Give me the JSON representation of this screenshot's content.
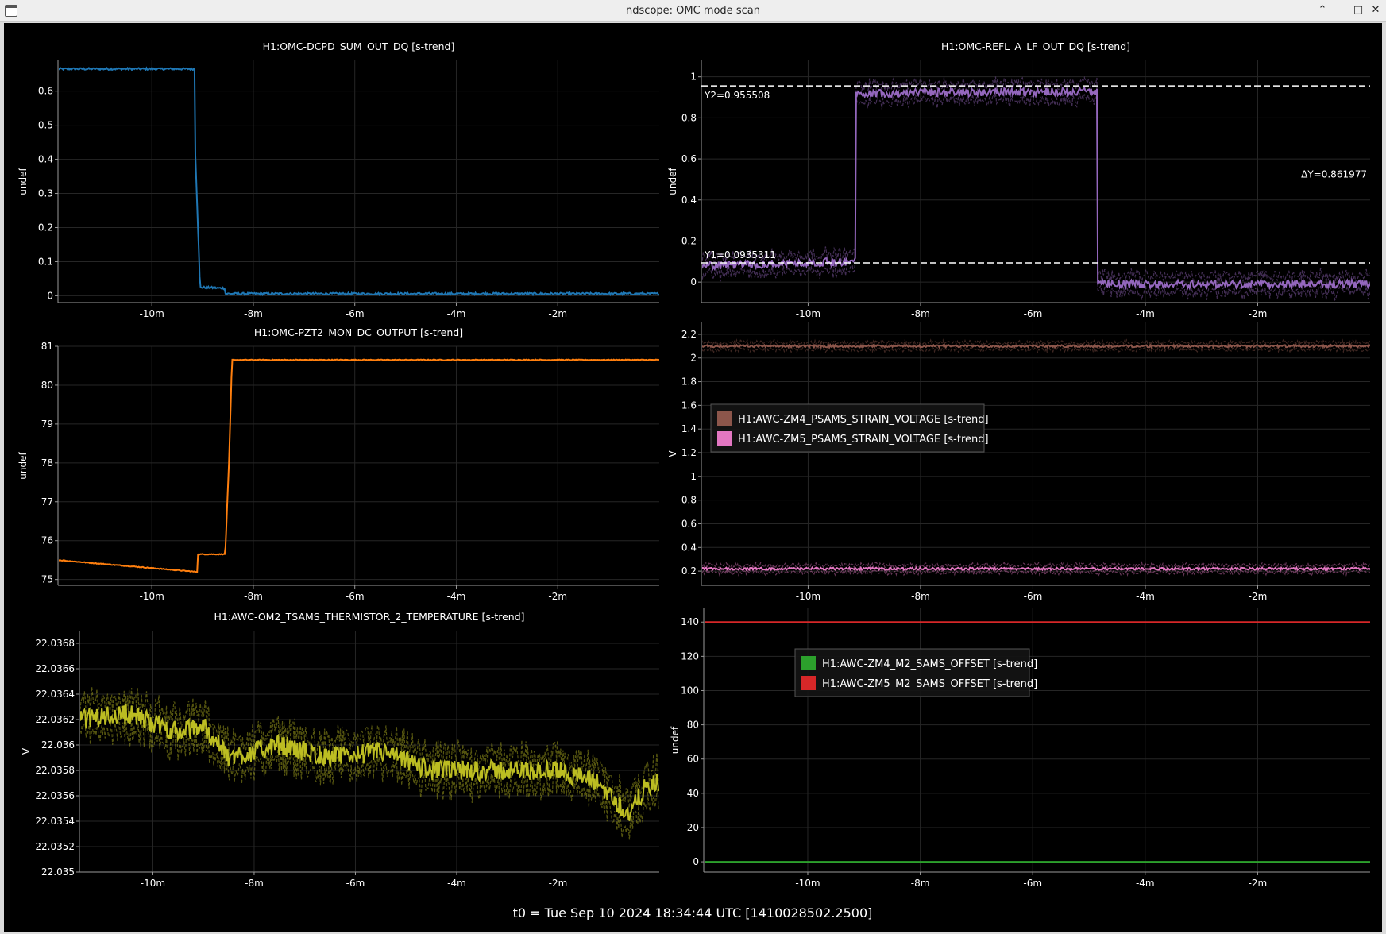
{
  "window": {
    "title": "ndscope: OMC mode scan",
    "app_icon": "window-icon",
    "buttons": [
      {
        "name": "keep-above-button",
        "glyph": "⌃"
      },
      {
        "name": "minimize-button",
        "glyph": "–"
      },
      {
        "name": "maximize-button",
        "glyph": "□"
      },
      {
        "name": "close-button",
        "glyph": "✕"
      }
    ]
  },
  "footer": {
    "t0": "t0 = Tue Sep 10 2024 18:34:44 UTC [1410028502.2500]"
  },
  "colors": {
    "background": "#000000",
    "blue": "#1f77b4",
    "orange": "#ff7f0e",
    "purple": "#9467bd",
    "brown": "#8c564b",
    "pink": "#e377c2",
    "yellow": "#bcbd22",
    "green": "#2ca02c",
    "red": "#d62728"
  },
  "chart_data": [
    {
      "id": "omc-dcpd",
      "type": "line",
      "title": "H1:OMC-DCPD_SUM_OUT_DQ [s-trend]",
      "ylabel": "undef",
      "xlim": [
        -11.85,
        -0.0
      ],
      "ylim": [
        -0.02,
        0.69
      ],
      "xticks": [
        -10,
        -8,
        -6,
        -4,
        -2
      ],
      "xtick_labels": [
        "-10m",
        "-8m",
        "-6m",
        "-4m",
        "-2m"
      ],
      "yticks": [
        0,
        0.1,
        0.2,
        0.3,
        0.4,
        0.5,
        0.6
      ],
      "ytick_labels": [
        "0",
        "0.1",
        "0.2",
        "0.3",
        "0.4",
        "0.5",
        "0.6"
      ],
      "series": [
        {
          "color": "#1f77b4",
          "noise": 0.003,
          "x": [
            -11.85,
            -9.15,
            -9.15,
            -9.05,
            -9.05,
            -8.55,
            -8.55,
            0.0
          ],
          "y": [
            0.665,
            0.665,
            0.45,
            0.025,
            0.025,
            0.022,
            0.006,
            0.006
          ]
        }
      ]
    },
    {
      "id": "omc-pzt2",
      "type": "line",
      "title": "H1:OMC-PZT2_MON_DC_OUTPUT [s-trend]",
      "ylabel": "undef",
      "xlim": [
        -11.85,
        -0.0
      ],
      "ylim": [
        74.85,
        81.0
      ],
      "xticks": [
        -10,
        -8,
        -6,
        -4,
        -2
      ],
      "xtick_labels": [
        "-10m",
        "-8m",
        "-6m",
        "-4m",
        "-2m"
      ],
      "yticks": [
        75,
        76,
        77,
        78,
        79,
        80,
        81
      ],
      "ytick_labels": [
        "75",
        "76",
        "77",
        "78",
        "79",
        "80",
        "81"
      ],
      "series": [
        {
          "color": "#ff7f0e",
          "noise": 0.01,
          "x": [
            -11.85,
            -9.15,
            -9.1,
            -9.1,
            -8.55,
            -8.55,
            -8.48,
            -8.42,
            0.0
          ],
          "y": [
            75.5,
            75.2,
            75.2,
            75.65,
            75.65,
            75.8,
            78.0,
            80.65,
            80.65
          ]
        }
      ]
    },
    {
      "id": "awc-thermistor",
      "type": "line",
      "title": "H1:AWC-OM2_TSAMS_THERMISTOR_2_TEMPERATURE [s-trend]",
      "ylabel": "V",
      "xlim": [
        -11.45,
        -0.0
      ],
      "ylim": [
        22.035,
        22.0369
      ],
      "xticks": [
        -10,
        -8,
        -6,
        -4,
        -2
      ],
      "xtick_labels": [
        "-10m",
        "-8m",
        "-6m",
        "-4m",
        "-2m"
      ],
      "yticks": [
        22.035,
        22.0352,
        22.0354,
        22.0356,
        22.0358,
        22.036,
        22.0362,
        22.0364,
        22.0366,
        22.0368
      ],
      "ytick_labels": [
        "22.035",
        "22.0352",
        "22.0354",
        "22.0356",
        "22.0358",
        "22.036",
        "22.0362",
        "22.0364",
        "22.0366",
        "22.0368"
      ],
      "series": [
        {
          "color": "#bcbd22",
          "noise": 8e-05,
          "band": 0.00012,
          "x": [
            -11.45,
            -10.5,
            -9.5,
            -9.0,
            -8.5,
            -7.5,
            -6.5,
            -5.5,
            -4.5,
            -3.0,
            -2.0,
            -1.2,
            -0.6,
            -0.3,
            0.0
          ],
          "y": [
            22.0362,
            22.03625,
            22.0361,
            22.03615,
            22.0359,
            22.036,
            22.0359,
            22.03595,
            22.0358,
            22.0358,
            22.0358,
            22.0357,
            22.03545,
            22.03565,
            22.0357
          ]
        }
      ]
    },
    {
      "id": "omc-refl",
      "type": "line",
      "title": "H1:OMC-REFL_A_LF_OUT_DQ [s-trend]",
      "ylabel": "undef",
      "xlim": [
        -11.9,
        -0.0
      ],
      "ylim": [
        -0.1,
        1.08
      ],
      "xticks": [
        -10,
        -8,
        -6,
        -4,
        -2
      ],
      "xtick_labels": [
        "-10m",
        "-8m",
        "-6m",
        "-4m",
        "-2m"
      ],
      "yticks": [
        0,
        0.2,
        0.4,
        0.6,
        0.8,
        1
      ],
      "ytick_labels": [
        "0",
        "0.2",
        "0.4",
        "0.6",
        "0.8",
        "1"
      ],
      "cursors": {
        "Y1": 0.0935311,
        "Y2": 0.955508,
        "Y1_label": "Y1=0.0935311",
        "Y2_label": "Y2=0.955508",
        "dY_label": "ΔY=0.861977"
      },
      "series": [
        {
          "color": "#9467bd",
          "noise": 0.02,
          "band": 0.04,
          "x": [
            -11.9,
            -9.2,
            -9.15,
            -9.15,
            -4.9,
            -4.85,
            -4.85,
            -4.8,
            0.0
          ],
          "y": [
            0.08,
            0.1,
            0.1,
            0.92,
            0.93,
            0.93,
            0.0,
            -0.01,
            -0.01
          ]
        }
      ]
    },
    {
      "id": "awc-strain",
      "type": "line",
      "title": "",
      "ylabel": "V",
      "xlim": [
        -11.9,
        -0.0
      ],
      "ylim": [
        0.08,
        2.3
      ],
      "xticks": [
        -10,
        -8,
        -6,
        -4,
        -2
      ],
      "xtick_labels": [
        "-10m",
        "-8m",
        "-6m",
        "-4m",
        "-2m"
      ],
      "yticks": [
        0.2,
        0.4,
        0.6,
        0.8,
        1,
        1.2,
        1.4,
        1.6,
        1.8,
        2,
        2.2
      ],
      "ytick_labels": [
        "0.2",
        "0.4",
        "0.6",
        "0.8",
        "1",
        "1.2",
        "1.4",
        "1.6",
        "1.8",
        "2",
        "2.2"
      ],
      "legend": {
        "position": "upper-left",
        "items": [
          {
            "label": "H1:AWC-ZM4_PSAMS_STRAIN_VOLTAGE [s-trend]",
            "color": "#8c564b"
          },
          {
            "label": "H1:AWC-ZM5_PSAMS_STRAIN_VOLTAGE [s-trend]",
            "color": "#e377c2"
          }
        ]
      },
      "series": [
        {
          "name": "H1:AWC-ZM4_PSAMS_STRAIN_VOLTAGE [s-trend]",
          "color": "#8c564b",
          "noise": 0.01,
          "band": 0.03,
          "x": [
            -11.9,
            0.0
          ],
          "y": [
            2.1,
            2.1
          ]
        },
        {
          "name": "H1:AWC-ZM5_PSAMS_STRAIN_VOLTAGE [s-trend]",
          "color": "#e377c2",
          "noise": 0.01,
          "band": 0.03,
          "x": [
            -11.9,
            0.0
          ],
          "y": [
            0.22,
            0.22
          ]
        }
      ]
    },
    {
      "id": "awc-offset",
      "type": "line",
      "title": "",
      "ylabel": "undef",
      "xlim": [
        -11.85,
        -0.0
      ],
      "ylim": [
        -6,
        148
      ],
      "xticks": [
        -10,
        -8,
        -6,
        -4,
        -2
      ],
      "xtick_labels": [
        "-10m",
        "-8m",
        "-6m",
        "-4m",
        "-2m"
      ],
      "yticks": [
        0,
        20,
        40,
        60,
        80,
        100,
        120,
        140
      ],
      "ytick_labels": [
        "0",
        "20",
        "40",
        "60",
        "80",
        "100",
        "120",
        "140"
      ],
      "legend": {
        "position": "upper-left",
        "items": [
          {
            "label": "H1:AWC-ZM4_M2_SAMS_OFFSET [s-trend]",
            "color": "#2ca02c"
          },
          {
            "label": "H1:AWC-ZM5_M2_SAMS_OFFSET [s-trend]",
            "color": "#d62728"
          }
        ]
      },
      "series": [
        {
          "name": "H1:AWC-ZM4_M2_SAMS_OFFSET [s-trend]",
          "color": "#2ca02c",
          "noise": 0,
          "x": [
            -11.85,
            0.0
          ],
          "y": [
            0,
            0
          ]
        },
        {
          "name": "H1:AWC-ZM5_M2_SAMS_OFFSET [s-trend]",
          "color": "#d62728",
          "noise": 0,
          "x": [
            -11.85,
            0.0
          ],
          "y": [
            140,
            140
          ]
        }
      ]
    }
  ]
}
